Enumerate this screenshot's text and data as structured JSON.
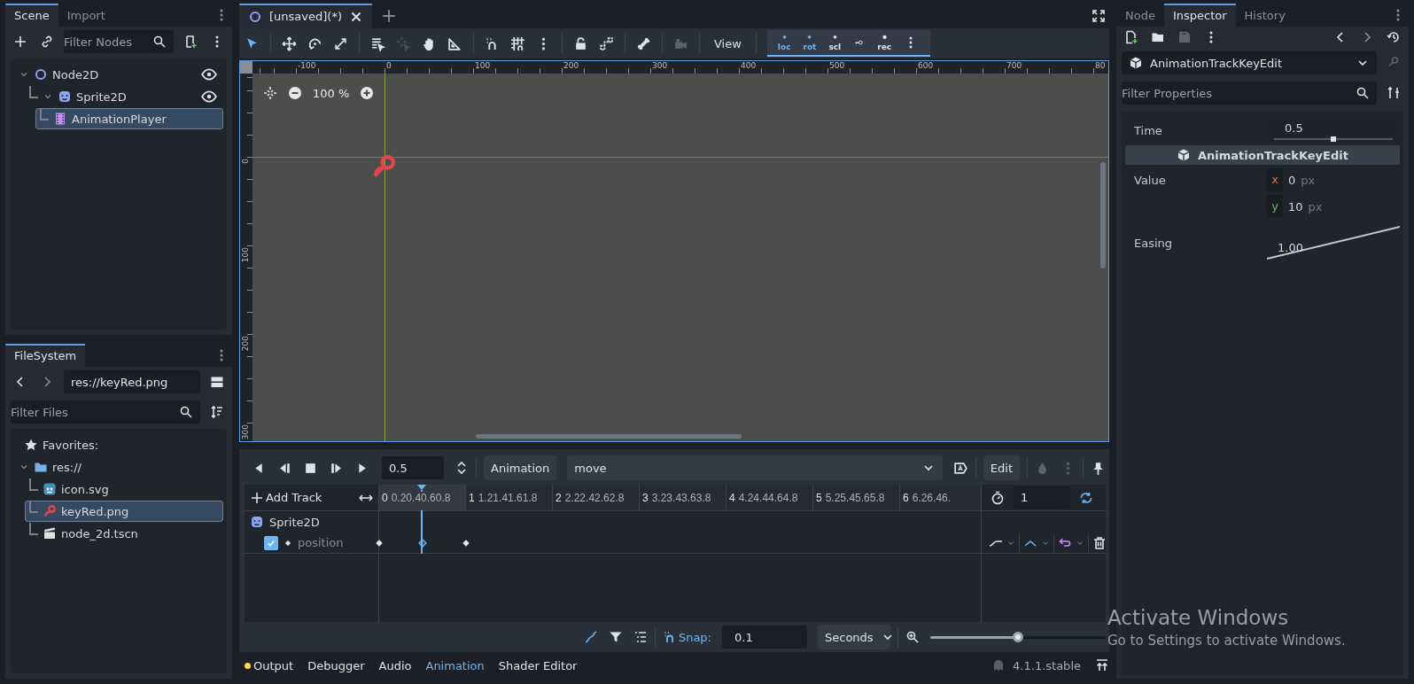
{
  "scene_dock": {
    "tabs": [
      {
        "label": "Scene",
        "selected": true
      },
      {
        "label": "Import",
        "selected": false
      }
    ],
    "filter": {
      "placeholder": "Filter Nodes"
    },
    "tree": [
      {
        "name": "Node2D",
        "kind": "node2d",
        "expanded": true,
        "visible": true,
        "selected": false,
        "children": [
          {
            "name": "Sprite2D",
            "kind": "sprite",
            "expanded": true,
            "visible": true,
            "selected": false,
            "children": [
              {
                "name": "AnimationPlayer",
                "kind": "animplayer",
                "selected": true
              }
            ]
          }
        ]
      }
    ]
  },
  "filesystem_dock": {
    "tabs": [
      {
        "label": "FileSystem",
        "selected": true
      }
    ],
    "path": "res://keyRed.png",
    "filter": {
      "placeholder": "Filter Files"
    },
    "favorites": "Favorites:",
    "tree": [
      {
        "name": "res://",
        "kind": "folder",
        "expanded": true,
        "selected": false,
        "children": [
          {
            "name": "icon.svg",
            "kind": "svg",
            "selected": false
          },
          {
            "name": "keyRed.png",
            "kind": "image",
            "selected": true
          },
          {
            "name": "node_2d.tscn",
            "kind": "scene",
            "selected": false
          }
        ]
      }
    ]
  },
  "editor_tabs": [
    {
      "label": "[unsaved](*)",
      "selected": true
    }
  ],
  "toolbar": {
    "tool_groups": [
      {
        "tools": [
          {
            "kind": "select",
            "selected": true,
            "disabled": false
          }
        ]
      },
      {
        "tools": [
          {
            "kind": "move",
            "selected": false,
            "disabled": false
          },
          {
            "kind": "rotate",
            "selected": false,
            "disabled": false
          },
          {
            "kind": "scale",
            "selected": false,
            "disabled": false
          }
        ]
      },
      {
        "tools": [
          {
            "kind": "list",
            "selected": false,
            "disabled": false
          },
          {
            "kind": "pivot",
            "selected": false,
            "disabled": true
          },
          {
            "kind": "pan",
            "selected": false,
            "disabled": false
          },
          {
            "kind": "ruler",
            "selected": false,
            "disabled": false
          }
        ]
      }
    ],
    "option_groups": [
      {
        "items": [
          {
            "kind": "smart_snap"
          },
          {
            "kind": "grid_snap"
          },
          {
            "kind": "more"
          }
        ]
      },
      {
        "items": [
          {
            "kind": "lock"
          },
          {
            "kind": "group"
          }
        ]
      },
      {
        "items": [
          {
            "kind": "bone"
          }
        ]
      },
      {
        "items": [
          {
            "kind": "camera",
            "disabled": true
          }
        ]
      }
    ],
    "view_menu": "View",
    "keying": [
      {
        "kind": "diamond",
        "label": "loc"
      },
      {
        "kind": "diamond",
        "label": "rot"
      },
      {
        "kind": "diamond",
        "label": "scl"
      },
      {
        "kind": "key"
      },
      {
        "kind": "dot",
        "label": "rec"
      }
    ]
  },
  "viewport": {
    "zoom": "100 %",
    "ruler_h": [
      "-100",
      "0",
      "100",
      "200",
      "300",
      "400",
      "500",
      "600",
      "700",
      "80"
    ],
    "ruler_v": [
      "0",
      "100",
      "200",
      "300"
    ]
  },
  "animation": {
    "time": "0.5",
    "menu": "Animation",
    "current": "move",
    "edit": "Edit",
    "add_track": "Add Track",
    "timeline": [
      {
        "major": "0",
        "minor": "0.20.40.60.8"
      },
      {
        "major": "1",
        "minor": "1.21.41.61.8"
      },
      {
        "major": "2",
        "minor": "2.22.42.62.8"
      },
      {
        "major": "3",
        "minor": "3.23.43.63.8"
      },
      {
        "major": "4",
        "minor": "4.24.44.64.8"
      },
      {
        "major": "5",
        "minor": "5.25.45.65.8"
      },
      {
        "major": "6",
        "minor": "6.26.46."
      }
    ],
    "length": "1",
    "loop": true,
    "tracks": [
      {
        "kind": "node",
        "name": "Sprite2D"
      },
      {
        "kind": "property",
        "name": "position",
        "checked": true,
        "keys": [
          {
            "selected": false
          },
          {
            "selected": true
          },
          {
            "selected": false
          }
        ]
      }
    ],
    "snap_on": true,
    "snap_label": "Snap:",
    "snap": "0.1",
    "snap_unit": "Seconds",
    "zoom": {
      "level": 0.5
    }
  },
  "bottom_tabs": [
    {
      "label": "Output",
      "selected": false,
      "notice": true
    },
    {
      "label": "Debugger",
      "selected": false,
      "notice": false
    },
    {
      "label": "Audio",
      "selected": false,
      "notice": false
    },
    {
      "label": "Animation",
      "selected": true,
      "notice": false
    },
    {
      "label": "Shader Editor",
      "selected": false,
      "notice": false
    }
  ],
  "version": "4.1.1.stable",
  "inspector": {
    "tabs": [
      {
        "label": "Node",
        "selected": false
      },
      {
        "label": "Inspector",
        "selected": true
      },
      {
        "label": "History",
        "selected": false
      }
    ],
    "object": "AnimationTrackKeyEdit",
    "filter": {
      "placeholder": "Filter Properties"
    },
    "properties": [
      {
        "kind": "slider",
        "label": "Time",
        "value": "0.5",
        "level": 0.5
      },
      {
        "kind": "section",
        "label": "AnimationTrackKeyEdit"
      },
      {
        "kind": "vector",
        "label": "Value",
        "components": [
          {
            "axis": "x",
            "value": "0",
            "unit": "px"
          },
          {
            "axis": "y",
            "value": "10",
            "unit": "px"
          }
        ]
      },
      {
        "kind": "easing",
        "label": "Easing",
        "value": "1.00"
      }
    ]
  },
  "os_notice": {
    "title": "Activate Windows",
    "text": "Go to Settings to activate Windows."
  }
}
